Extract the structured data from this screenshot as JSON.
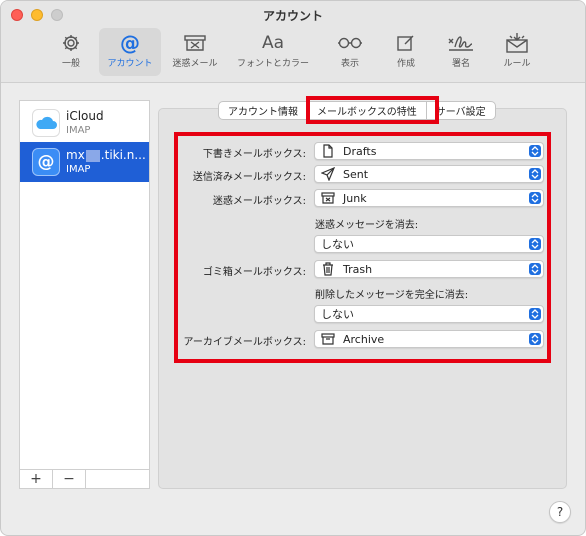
{
  "window": {
    "title": "アカウント"
  },
  "toolbar": {
    "items": [
      {
        "label": "一般"
      },
      {
        "label": "アカウント"
      },
      {
        "label": "迷惑メール"
      },
      {
        "label": "フォントとカラー",
        "glyph": "Aa"
      },
      {
        "label": "表示"
      },
      {
        "label": "作成"
      },
      {
        "label": "署名"
      },
      {
        "label": "ルール"
      }
    ]
  },
  "sidebar": {
    "accounts": [
      {
        "name": "iCloud",
        "type": "IMAP"
      },
      {
        "name_prefix": "mx",
        "name_suffix": ".tiki.n...",
        "type": "IMAP"
      }
    ],
    "add_label": "+",
    "remove_label": "−"
  },
  "tabs": [
    {
      "label": "アカウント情報"
    },
    {
      "label": "メールボックスの特性"
    },
    {
      "label": "サーバ設定"
    }
  ],
  "form": {
    "drafts": {
      "label": "下書きメールボックス:",
      "value": "Drafts",
      "icon": "document-icon"
    },
    "sent": {
      "label": "送信済みメールボックス:",
      "value": "Sent",
      "icon": "paper-plane-icon"
    },
    "junk": {
      "label": "迷惑メールボックス:",
      "value": "Junk",
      "icon": "junk-tray-icon"
    },
    "junk_erase": {
      "label": "迷惑メッセージを消去:",
      "value": "しない"
    },
    "trash": {
      "label": "ゴミ箱メールボックス:",
      "value": "Trash",
      "icon": "trash-icon"
    },
    "trash_erase": {
      "label": "削除したメッセージを完全に消去:",
      "value": "しない"
    },
    "archive": {
      "label": "アーカイブメールボックス:",
      "value": "Archive",
      "icon": "archive-box-icon"
    }
  },
  "help": {
    "label": "?"
  },
  "colors": {
    "accent": "#1f6fe0",
    "selection": "#1f5fd6",
    "highlight": "#e60012"
  }
}
